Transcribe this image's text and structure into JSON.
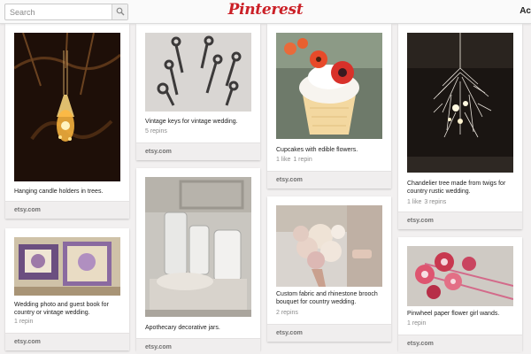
{
  "header": {
    "search_placeholder": "Search",
    "logo_text": "Pinterest",
    "right_label": "Ac",
    "brand_color": "#cb2027"
  },
  "pins": [
    {
      "description": "Hanging candle holders in trees.",
      "stats": [],
      "source": "etsy.com"
    },
    {
      "description": "Vintage keys for vintage wedding.",
      "stats": [
        "5 repins"
      ],
      "source": "etsy.com"
    },
    {
      "description": "Cupcakes with edible flowers.",
      "stats": [
        "1 like",
        "1 repin"
      ],
      "source": "etsy.com"
    },
    {
      "description": "Chandelier tree made from twigs for country rustic wedding.",
      "stats": [
        "1 like",
        "3 repins"
      ],
      "source": "etsy.com"
    },
    {
      "description": "Wedding photo and guest book for country or vintage wedding.",
      "stats": [
        "1 repin"
      ],
      "source": "etsy.com"
    },
    {
      "description": "Apothecary decorative jars.",
      "stats": [],
      "source": "etsy.com"
    },
    {
      "description": "Custom fabric and rhinestone brooch bouquet for country wedding.",
      "stats": [
        "2 repins"
      ],
      "source": "etsy.com"
    },
    {
      "description": "Pinwheel paper flower girl wands.",
      "stats": [
        "1 repin"
      ],
      "source": "etsy.com"
    }
  ]
}
